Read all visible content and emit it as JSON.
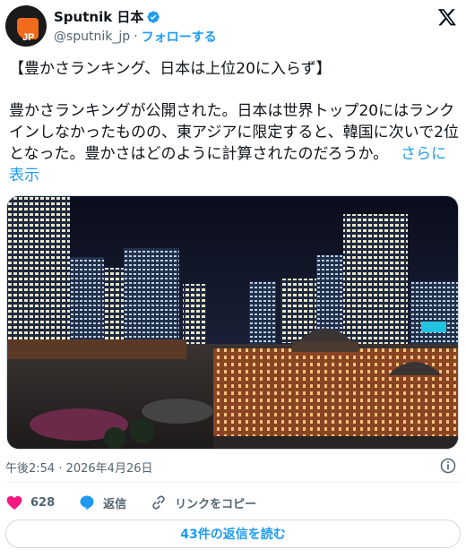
{
  "account": {
    "display_name": "Sputnik 日本",
    "handle": "@sputnik_jp",
    "separator": "·",
    "follow_label": "フォローする",
    "avatar_text": "JP"
  },
  "tweet": {
    "headline": "【豊かさランキング、日本は上位20に入らず】",
    "body": "豊かさランキングが公開された。日本は世界トップ20にはランクインしなかったものの、東アジアに限定すると、韓国に次いで2位となった。豊かさはどのように計算されたのだろうか。",
    "more_label": "さらに表示",
    "timestamp": "午後2:54 · 2026年4月26日"
  },
  "actions": {
    "like_count": "628",
    "reply_label": "返信",
    "copy_link_label": "リンクをコピー"
  },
  "read_replies_label": "43件の返信を読む",
  "colors": {
    "accent": "#1d9bf0",
    "like": "#f91880",
    "brand": "#f26b1d"
  },
  "icons": [
    "verified-badge-icon",
    "x-logo-icon",
    "info-icon",
    "heart-icon",
    "reply-bubble-icon",
    "link-icon"
  ]
}
